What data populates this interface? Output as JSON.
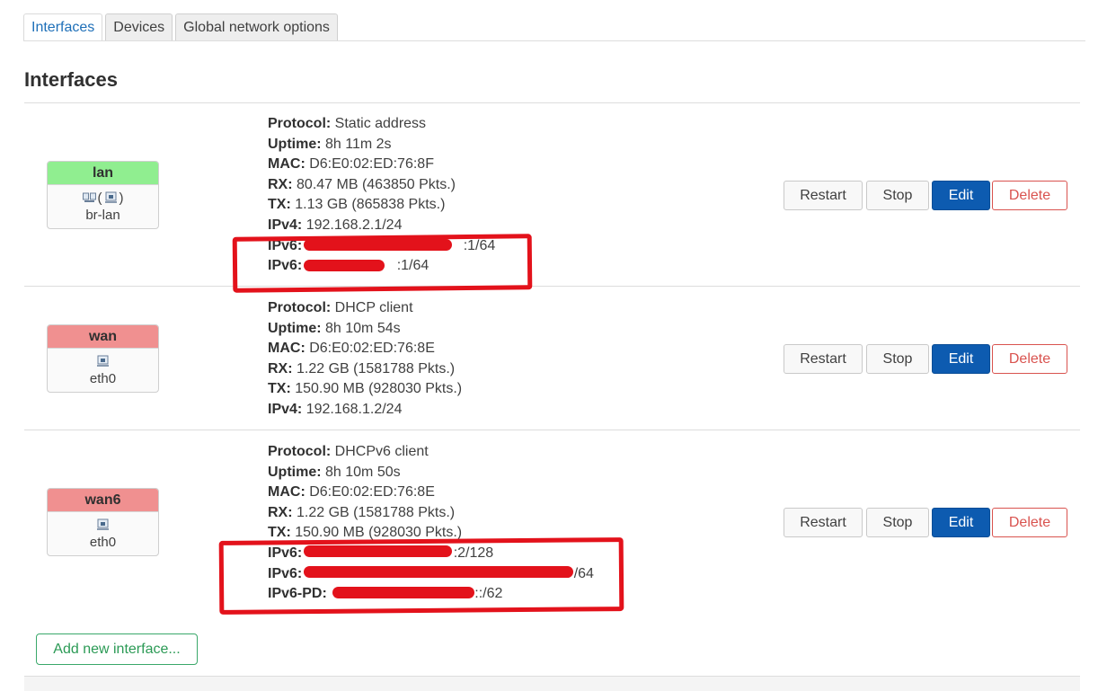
{
  "tabs": [
    {
      "label": "Interfaces",
      "active": true
    },
    {
      "label": "Devices",
      "active": false
    },
    {
      "label": "Global network options",
      "active": false
    }
  ],
  "page_title": "Interfaces",
  "interfaces": [
    {
      "name": "lan",
      "header_color": "#90ee90",
      "device": "br-lan",
      "icons": [
        "bridge-icon",
        "ethernet-port-icon"
      ],
      "lines": [
        {
          "key": "Protocol:",
          "value": "Static address"
        },
        {
          "key": "Uptime:",
          "value": "8h 11m 2s"
        },
        {
          "key": "MAC:",
          "value": "D6:E0:02:ED:76:8F"
        },
        {
          "key": "RX:",
          "value": "80.47 MB (463850 Pkts.)"
        },
        {
          "key": "TX:",
          "value": "1.13 GB (865838 Pkts.)"
        },
        {
          "key": "IPv4:",
          "value": "192.168.2.1/24"
        },
        {
          "key": "IPv6:",
          "value": ":1/64"
        },
        {
          "key": "IPv6:",
          "value": ":1/64"
        }
      ]
    },
    {
      "name": "wan",
      "header_color": "#f09090",
      "device": "eth0",
      "icons": [
        "ethernet-port-icon"
      ],
      "lines": [
        {
          "key": "Protocol:",
          "value": "DHCP client"
        },
        {
          "key": "Uptime:",
          "value": "8h 10m 54s"
        },
        {
          "key": "MAC:",
          "value": "D6:E0:02:ED:76:8E"
        },
        {
          "key": "RX:",
          "value": "1.22 GB (1581788 Pkts.)"
        },
        {
          "key": "TX:",
          "value": "150.90 MB (928030 Pkts.)"
        },
        {
          "key": "IPv4:",
          "value": "192.168.1.2/24"
        }
      ]
    },
    {
      "name": "wan6",
      "header_color": "#f09090",
      "device": "eth0",
      "icons": [
        "ethernet-port-icon"
      ],
      "lines": [
        {
          "key": "Protocol:",
          "value": "DHCPv6 client"
        },
        {
          "key": "Uptime:",
          "value": "8h 10m 50s"
        },
        {
          "key": "MAC:",
          "value": "D6:E0:02:ED:76:8E"
        },
        {
          "key": "RX:",
          "value": "1.22 GB (1581788 Pkts.)"
        },
        {
          "key": "TX:",
          "value": "150.90 MB (928030 Pkts.)"
        },
        {
          "key": "IPv6:",
          "value": ":2/128"
        },
        {
          "key": "IPv6:",
          "value": "/64"
        },
        {
          "key": "IPv6-PD:",
          "value": "::/62"
        }
      ]
    }
  ],
  "buttons": {
    "restart": "Restart",
    "stop": "Stop",
    "edit": "Edit",
    "delete": "Delete"
  },
  "add_interface_label": "Add new interface...",
  "colors": {
    "accent_blue": "#0d5bb0",
    "delete_red": "#d9534f",
    "add_green": "#2b9a55",
    "redaction_red": "#e3121b"
  }
}
